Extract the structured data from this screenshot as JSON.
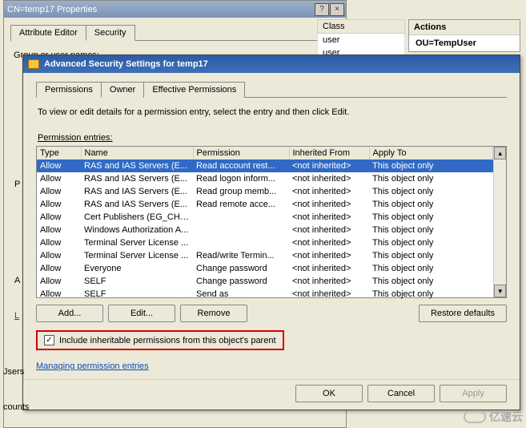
{
  "prop_window": {
    "title": "CN=temp17 Properties",
    "tabs": [
      "Attribute Editor",
      "Security"
    ],
    "active_tab": 1,
    "group_label": "Group or user names:"
  },
  "bg_grid": {
    "header": "Class",
    "rows": [
      "user",
      "user"
    ]
  },
  "actions": {
    "header": "Actions",
    "item": "OU=TempUser"
  },
  "adv": {
    "title": "Advanced Security Settings for temp17",
    "tabs": [
      "Permissions",
      "Owner",
      "Effective Permissions"
    ],
    "intro": "To view or edit details for a permission entry, select the entry and then click Edit.",
    "entries_label": "Permission entries:",
    "columns": [
      "Type",
      "Name",
      "Permission",
      "Inherited From",
      "Apply To"
    ],
    "rows": [
      {
        "type": "Allow",
        "name": "RAS and IAS Servers (E...",
        "perm": "Read account rest...",
        "inh": "<not inherited>",
        "apply": "This object only",
        "selected": true
      },
      {
        "type": "Allow",
        "name": "RAS and IAS Servers (E...",
        "perm": "Read logon inform...",
        "inh": "<not inherited>",
        "apply": "This object only"
      },
      {
        "type": "Allow",
        "name": "RAS and IAS Servers (E...",
        "perm": "Read group memb...",
        "inh": "<not inherited>",
        "apply": "This object only"
      },
      {
        "type": "Allow",
        "name": "RAS and IAS Servers (E...",
        "perm": "Read remote acce...",
        "inh": "<not inherited>",
        "apply": "This object only"
      },
      {
        "type": "Allow",
        "name": "Cert Publishers (EG_CH\\...",
        "perm": "",
        "inh": "<not inherited>",
        "apply": "This object only"
      },
      {
        "type": "Allow",
        "name": "Windows Authorization A...",
        "perm": "",
        "inh": "<not inherited>",
        "apply": "This object only"
      },
      {
        "type": "Allow",
        "name": "Terminal Server License ...",
        "perm": "",
        "inh": "<not inherited>",
        "apply": "This object only"
      },
      {
        "type": "Allow",
        "name": "Terminal Server License ...",
        "perm": "Read/write Termin...",
        "inh": "<not inherited>",
        "apply": "This object only"
      },
      {
        "type": "Allow",
        "name": "Everyone",
        "perm": "Change password",
        "inh": "<not inherited>",
        "apply": "This object only"
      },
      {
        "type": "Allow",
        "name": "SELF",
        "perm": "Change password",
        "inh": "<not inherited>",
        "apply": "This object only"
      },
      {
        "type": "Allow",
        "name": "SELF",
        "perm": "Send as",
        "inh": "<not inherited>",
        "apply": "This object only"
      }
    ],
    "buttons": {
      "add": "Add...",
      "edit": "Edit...",
      "remove": "Remove",
      "restore": "Restore defaults"
    },
    "inherit_checkbox": "Include inheritable permissions from this object's parent",
    "link": "Managing permission entries",
    "ok": "OK",
    "cancel": "Cancel",
    "apply": "Apply"
  },
  "left_labels": {
    "p": "P",
    "a": "A",
    "l": "L"
  },
  "status": {
    "users": "Jsers",
    "counts": "counts"
  },
  "watermark": "亿速云"
}
